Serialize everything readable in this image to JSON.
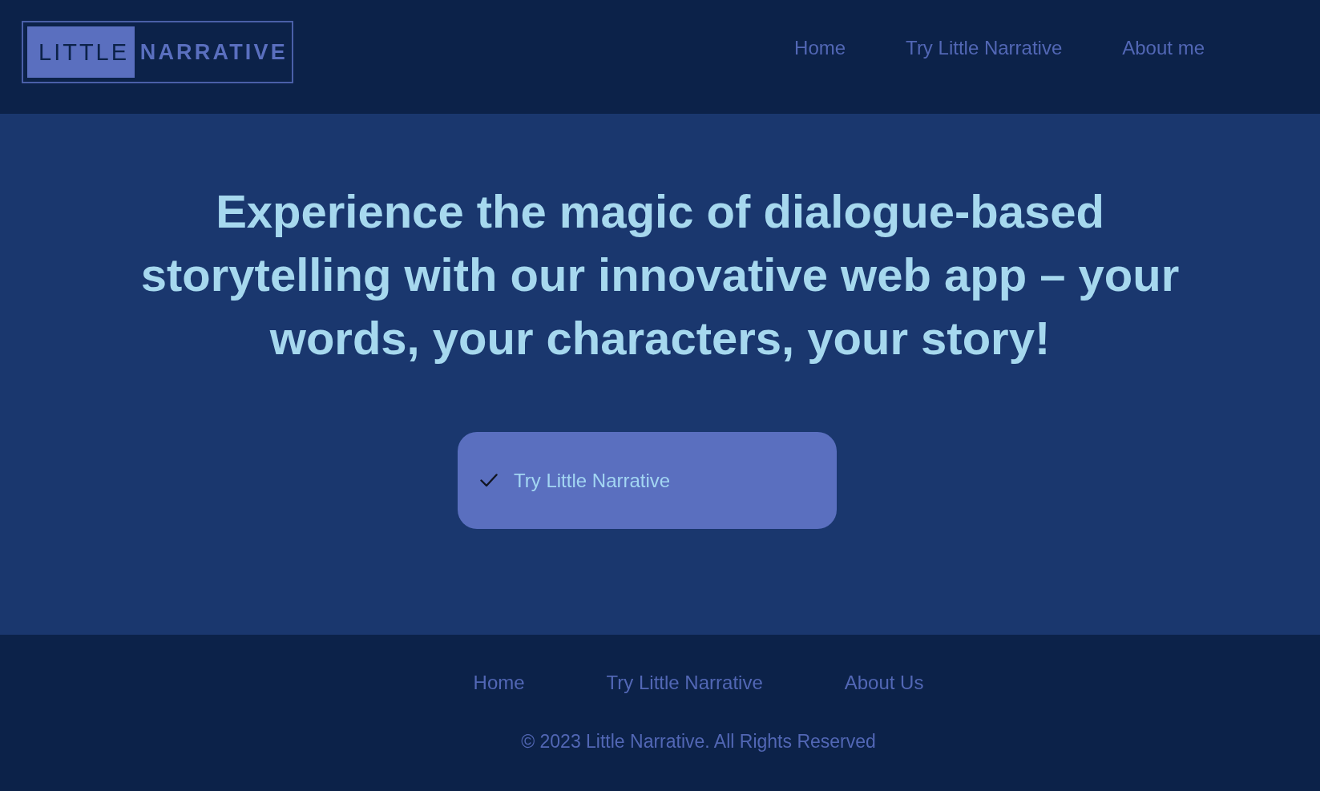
{
  "header": {
    "logo": {
      "word_1": "LITTLE",
      "word_2": "NARRATIVE"
    },
    "nav": [
      {
        "label": "Home"
      },
      {
        "label": "Try Little Narrative"
      },
      {
        "label": "About me"
      }
    ]
  },
  "hero": {
    "heading": "Experience the magic of dialogue-based storytelling with our innovative web app – your words, your characters, your story!",
    "cta": {
      "label": "Try Little Narrative"
    }
  },
  "footer": {
    "links": [
      {
        "label": "Home"
      },
      {
        "label": "Try Little Narrative"
      },
      {
        "label": "About Us"
      }
    ],
    "copyright": "© 2023 Little Narrative. All Rights Reserved"
  }
}
